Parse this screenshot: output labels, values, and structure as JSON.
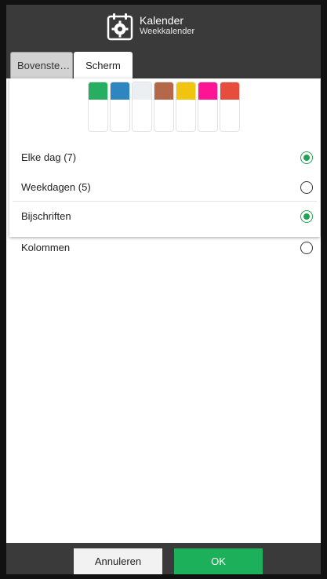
{
  "header": {
    "title": "Kalender",
    "subtitle": "Weekkalender",
    "icon": "calendar-gear-icon"
  },
  "tabs": [
    {
      "label": "Bovenste…",
      "active": false
    },
    {
      "label": "Scherm",
      "active": true
    }
  ],
  "swatches": [
    "#27ae60",
    "#2e86c1",
    "#eceff1",
    "#b5674a",
    "#f1c40f",
    "#ff1493",
    "#e74c3c"
  ],
  "options": [
    {
      "label": "Elke dag (7)",
      "selected": true
    },
    {
      "label": "Weekdagen (5)",
      "selected": false
    },
    {
      "label": "Bijschriften",
      "selected": true
    },
    {
      "label": "Kolommen",
      "selected": false
    }
  ],
  "footer": {
    "cancel_label": "Annuleren",
    "ok_label": "OK"
  },
  "colors": {
    "accent": "#24a154",
    "ok_button": "#1db05a",
    "chrome": "#3a3a3a"
  }
}
